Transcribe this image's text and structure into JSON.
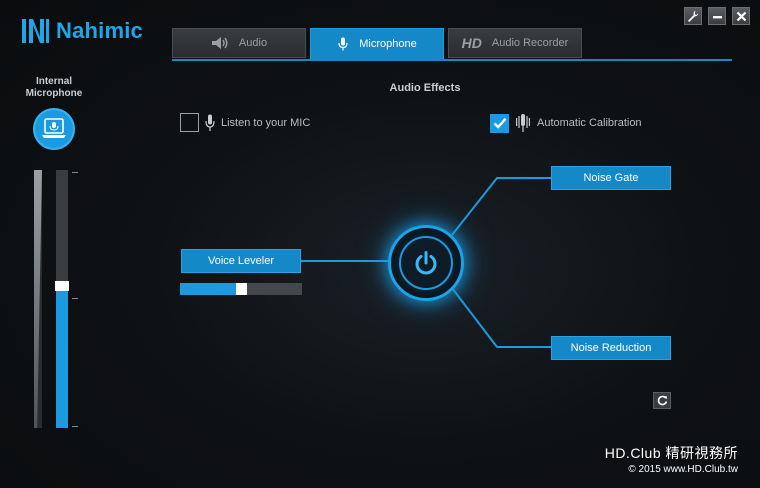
{
  "app": {
    "logo_text": "Nahimic"
  },
  "tabs": [
    {
      "label": "Audio",
      "icon": "speaker-icon"
    },
    {
      "label": "Microphone",
      "icon": "microphone-icon",
      "active": true
    },
    {
      "label": "Audio Recorder",
      "icon": "hd-icon",
      "badge": "HD"
    }
  ],
  "window_controls": [
    "settings-wrench-icon",
    "minimize-icon",
    "close-icon"
  ],
  "device": {
    "label_line1": "Internal",
    "label_line2": "Microphone",
    "icon": "laptop-microphone-icon",
    "volume_level_pct": 55
  },
  "effects": {
    "title": "Audio Effects",
    "listen_label": "Listen to your MIC",
    "listen_checked": false,
    "calibration_label": "Automatic Calibration",
    "calibration_checked": true,
    "voice_leveler": "Voice Leveler",
    "voice_leveler_level_pct": 50,
    "noise_gate": "Noise Gate",
    "noise_reduction": "Noise Reduction",
    "power_icon": "power-icon",
    "reset_icon": "reset-icon"
  },
  "watermark": {
    "line1": "HD.Club 精研視務所",
    "line2": "© 2015  www.HD.Club.tw"
  },
  "colors": {
    "accent": "#1a9ae0",
    "background": "#0f1215",
    "tab_inactive": "#2f3234"
  }
}
